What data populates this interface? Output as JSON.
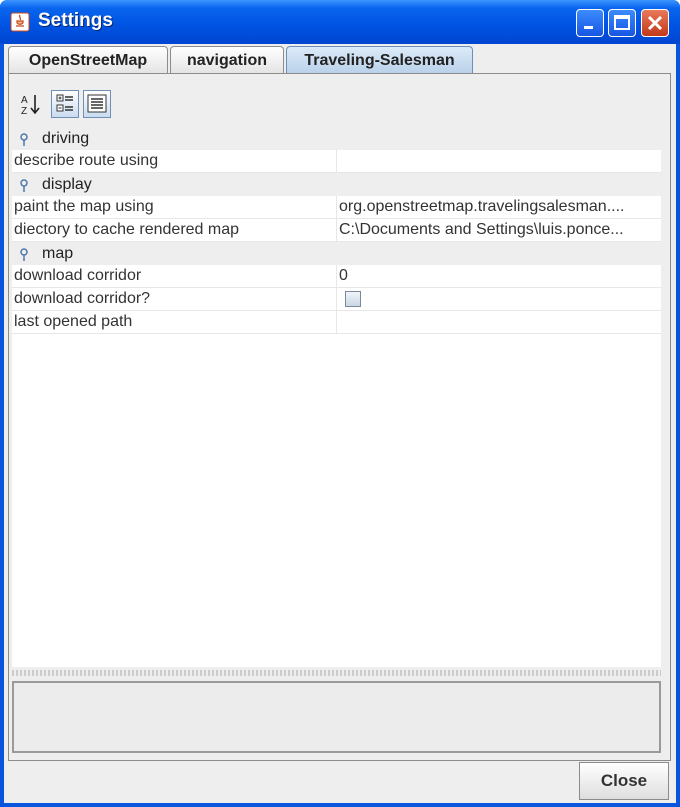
{
  "window": {
    "title": "Settings"
  },
  "tabs": [
    {
      "label": "OpenStreetMap",
      "selected": false
    },
    {
      "label": "navigation",
      "selected": false
    },
    {
      "label": "Traveling-Salesman",
      "selected": true
    }
  ],
  "toolbar": {
    "sort_icon": "sort-alphabetical-icon",
    "categorized_icon": "categorized-view-icon",
    "description_icon": "description-view-icon"
  },
  "sheet": {
    "categories": [
      {
        "name": "driving",
        "rows": [
          {
            "name": "describe route using",
            "value": ""
          }
        ]
      },
      {
        "name": "display",
        "rows": [
          {
            "name": "paint the map using",
            "value": "org.openstreetmap.travelingsalesman...."
          },
          {
            "name": "diectory to cache rendered map",
            "value": "C:\\Documents and Settings\\luis.ponce..."
          }
        ]
      },
      {
        "name": "map",
        "rows": [
          {
            "name": "download corridor",
            "value": "0"
          },
          {
            "name": "download corridor?",
            "value": "",
            "checked": false
          },
          {
            "name": "last opened path",
            "value": ""
          }
        ]
      }
    ]
  },
  "buttons": {
    "close": "Close"
  }
}
